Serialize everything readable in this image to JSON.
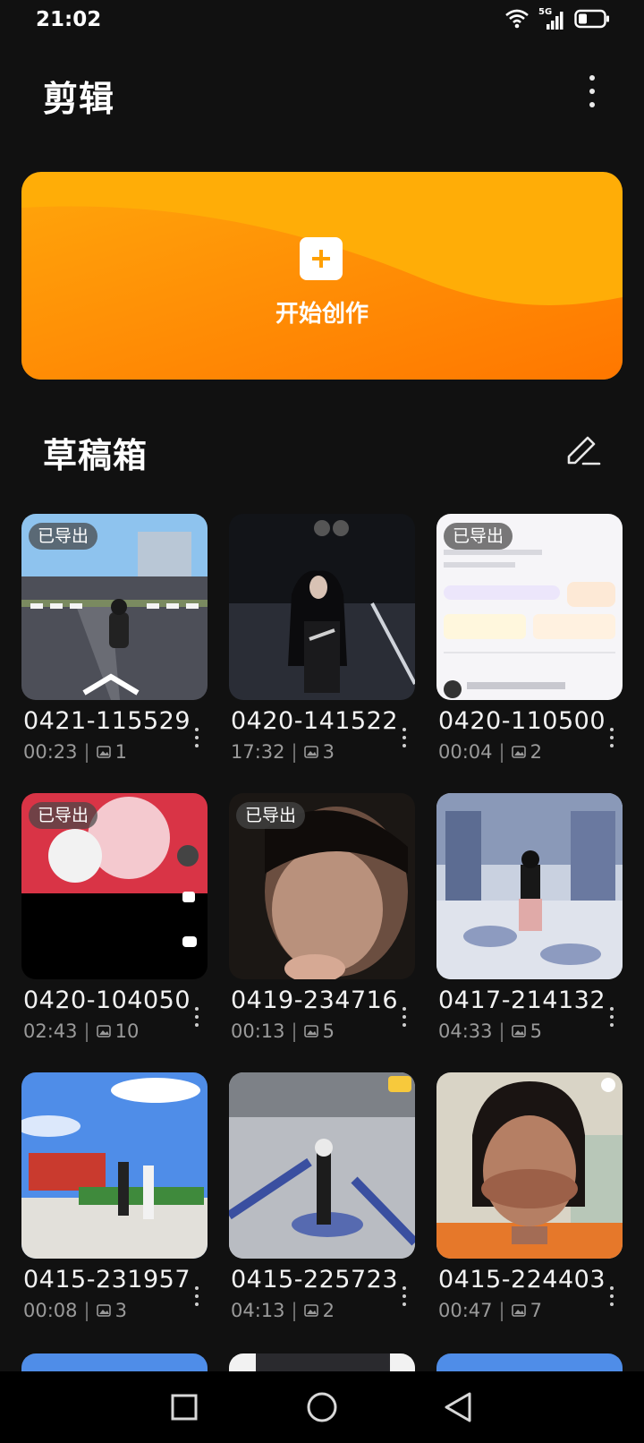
{
  "status_bar": {
    "time": "21:02",
    "network": "5G",
    "icons": [
      "wifi-icon",
      "signal-icon",
      "battery-icon"
    ]
  },
  "header": {
    "title": "剪辑",
    "menu_icon": "more-vertical-icon"
  },
  "banner": {
    "label": "开始创作",
    "icon": "plus-icon",
    "colors": {
      "top": "#ffad07",
      "wave": "#ff8a00",
      "deep": "#ff7800"
    }
  },
  "drafts": {
    "title": "草稿箱",
    "edit_icon": "edit-pen-icon",
    "exported_label": "已导出",
    "items": [
      {
        "title": "0421-115529",
        "duration": "00:23",
        "separator": "|",
        "count": "1",
        "exported": true
      },
      {
        "title": "0420-141522",
        "duration": "17:32",
        "separator": "|",
        "count": "3",
        "exported": false
      },
      {
        "title": "0420-110500",
        "duration": "00:04",
        "separator": "|",
        "count": "2",
        "exported": true
      },
      {
        "title": "0420-104050",
        "duration": "02:43",
        "separator": "|",
        "count": "10",
        "exported": true
      },
      {
        "title": "0419-234716",
        "duration": "00:13",
        "separator": "|",
        "count": "5",
        "exported": true
      },
      {
        "title": "0417-214132",
        "duration": "04:33",
        "separator": "|",
        "count": "5",
        "exported": false
      },
      {
        "title": "0415-231957",
        "duration": "00:08",
        "separator": "|",
        "count": "3",
        "exported": false
      },
      {
        "title": "0415-225723",
        "duration": "04:13",
        "separator": "|",
        "count": "2",
        "exported": false
      },
      {
        "title": "0415-224403",
        "duration": "00:47",
        "separator": "|",
        "count": "7",
        "exported": false
      }
    ]
  },
  "nav_bar": {
    "buttons": [
      "recents-square-icon",
      "home-circle-icon",
      "back-triangle-icon"
    ]
  }
}
